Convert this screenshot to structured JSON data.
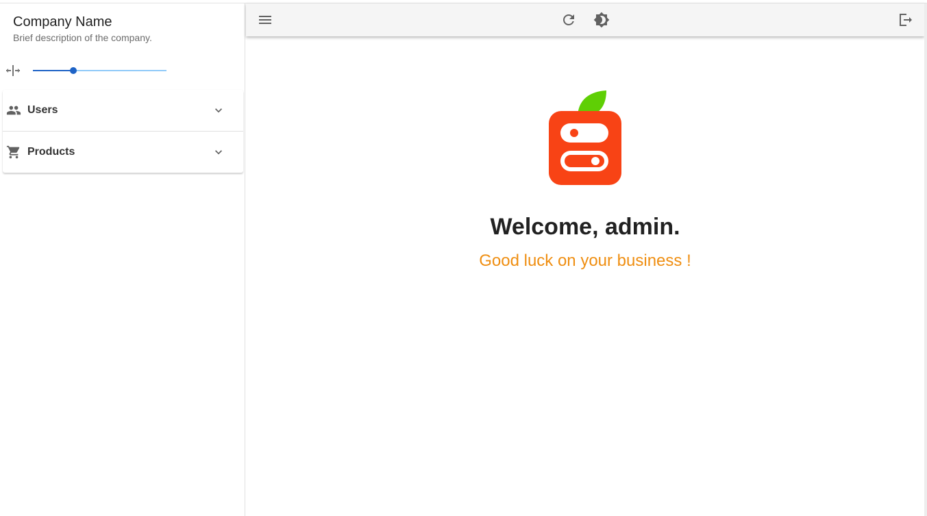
{
  "sidebar": {
    "company_name": "Company Name",
    "company_description": "Brief description of the company.",
    "width_slider": {
      "icon": "width-adjust-icon",
      "value_fraction": 0.3
    },
    "menu": [
      {
        "label": "Users",
        "icon": "people-icon"
      },
      {
        "label": "Products",
        "icon": "cart-icon"
      }
    ]
  },
  "topbar": {
    "icons": [
      "menu-icon",
      "refresh-icon",
      "brightness-icon",
      "logout-icon"
    ]
  },
  "main": {
    "logo": "apple-server-logo",
    "welcome": "Welcome, admin.",
    "subtitle": "Good luck on your business !"
  },
  "colors": {
    "accent": "#1e63c6",
    "subtitle": "#ef8e11",
    "logo_red": "#f84315",
    "logo_leaf": "#5fcf05"
  }
}
